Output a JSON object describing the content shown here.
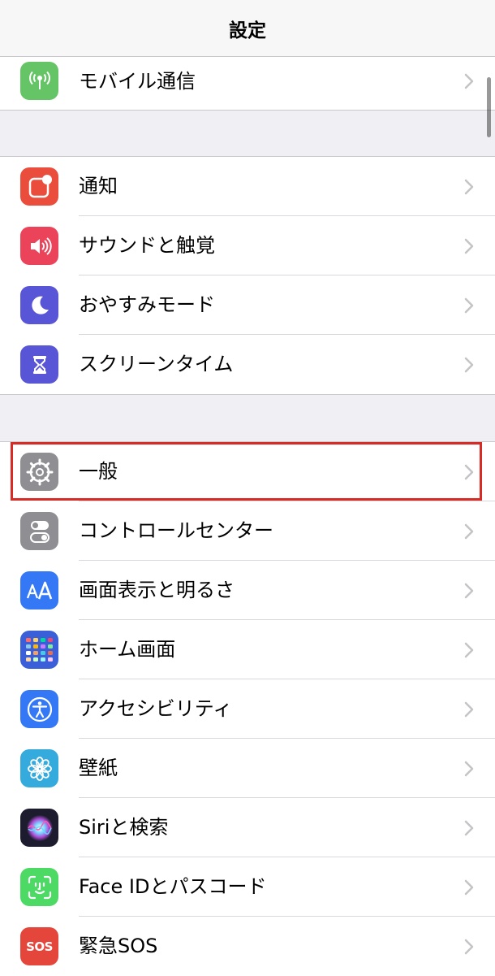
{
  "header": {
    "title": "設定"
  },
  "groups": [
    {
      "items": [
        {
          "label": "モバイル通信",
          "icon": "antenna-icon",
          "color": "#65c466"
        }
      ]
    },
    {
      "items": [
        {
          "label": "通知",
          "icon": "notification-icon",
          "color": "#eb4d3d"
        },
        {
          "label": "サウンドと触覚",
          "icon": "speaker-icon",
          "color": "#eb445a"
        },
        {
          "label": "おやすみモード",
          "icon": "moon-icon",
          "color": "#5856d6"
        },
        {
          "label": "スクリーンタイム",
          "icon": "hourglass-icon",
          "color": "#5856d6"
        }
      ]
    },
    {
      "items": [
        {
          "label": "一般",
          "icon": "gear-icon",
          "color": "#8e8e93"
        },
        {
          "label": "コントロールセンター",
          "icon": "toggles-icon",
          "color": "#8e8e93"
        },
        {
          "label": "画面表示と明るさ",
          "icon": "text-size-icon",
          "color": "#3478f6"
        },
        {
          "label": "ホーム画面",
          "icon": "app-grid-icon",
          "color": "#3a5fd9"
        },
        {
          "label": "アクセシビリティ",
          "icon": "accessibility-icon",
          "color": "#3478f6"
        },
        {
          "label": "壁紙",
          "icon": "flower-icon",
          "color": "#35aadc"
        },
        {
          "label": "Siriと検索",
          "icon": "siri-icon",
          "color": "#1c1c2e"
        },
        {
          "label": "Face IDとパスコード",
          "icon": "face-id-icon",
          "color": "#4cd964"
        },
        {
          "label": "緊急SOS",
          "icon": "sos-icon",
          "color": "#e5463c",
          "text": "SOS"
        }
      ]
    }
  ],
  "highlight_color": "#d92b26"
}
